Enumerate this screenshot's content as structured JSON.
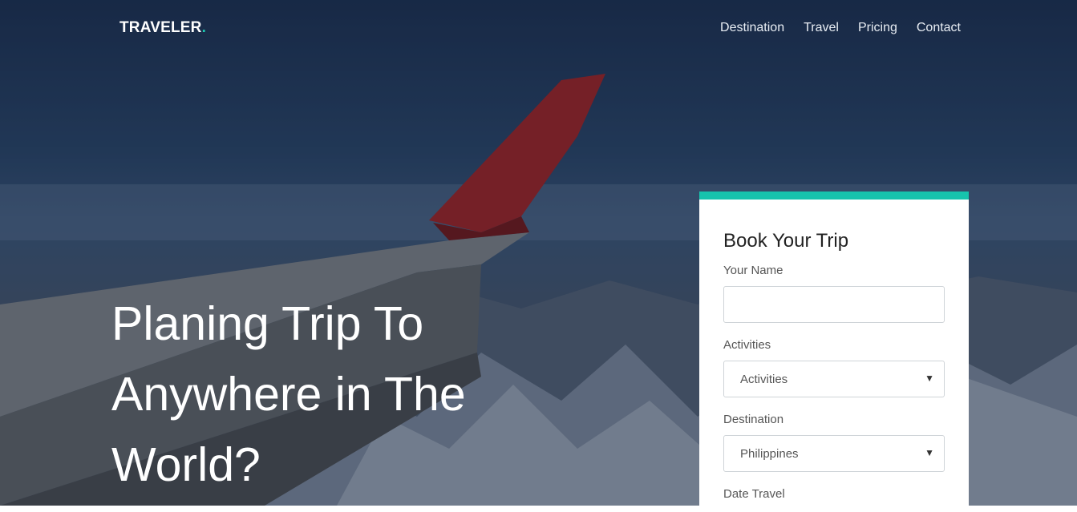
{
  "brand": {
    "name": "TRAVELER",
    "dot": ".",
    "accent": "#1cc7b0"
  },
  "nav": {
    "items": [
      "Destination",
      "Travel",
      "Pricing",
      "Contact"
    ]
  },
  "hero": {
    "headline_lines": [
      "Planing Trip To",
      "Anywhere in The",
      "World?"
    ]
  },
  "booking": {
    "title": "Book Your Trip",
    "name_label": "Your Name",
    "name_value": "",
    "activities_label": "Activities",
    "activities_value": "Activities",
    "destination_label": "Destination",
    "destination_value": "Philippines",
    "date_label": "Date Travel",
    "accent": "#17c3ad"
  },
  "icons": {
    "select_arrow": "chevron-down-icon"
  }
}
